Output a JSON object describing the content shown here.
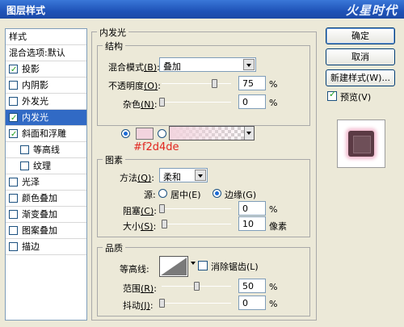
{
  "window": {
    "title": "图层样式",
    "watermark": "火星时代"
  },
  "style_list": {
    "header": "样式",
    "items": [
      {
        "label": "混合选项:默认",
        "checkbox": false
      },
      {
        "label": "投影",
        "checkbox": true,
        "checked": true
      },
      {
        "label": "内阴影",
        "checkbox": true,
        "checked": false
      },
      {
        "label": "外发光",
        "checkbox": true,
        "checked": false
      },
      {
        "label": "内发光",
        "checkbox": true,
        "checked": true,
        "selected": true
      },
      {
        "label": "斜面和浮雕",
        "checkbox": true,
        "checked": true
      },
      {
        "label": "等高线",
        "checkbox": true,
        "checked": false,
        "indent": true
      },
      {
        "label": "纹理",
        "checkbox": true,
        "checked": false,
        "indent": true
      },
      {
        "label": "光泽",
        "checkbox": true,
        "checked": false
      },
      {
        "label": "颜色叠加",
        "checkbox": true,
        "checked": false
      },
      {
        "label": "渐变叠加",
        "checkbox": true,
        "checked": false
      },
      {
        "label": "图案叠加",
        "checkbox": true,
        "checked": false
      },
      {
        "label": "描边",
        "checkbox": true,
        "checked": false
      }
    ]
  },
  "panel": {
    "title": "内发光",
    "structure": {
      "label": "结构",
      "blend_mode": {
        "label": "混合模式",
        "hotkey": "(B)",
        "value": "叠加"
      },
      "opacity": {
        "label": "不透明度",
        "hotkey": "(O)",
        "value": "75",
        "unit": "%",
        "fraction": 0.75
      },
      "noise": {
        "label": "杂色",
        "hotkey": "(N)",
        "value": "0",
        "unit": "%",
        "fraction": 0
      },
      "color_hex": "#f2d4de",
      "color_label": "#f2d4de"
    },
    "elements": {
      "label": "图素",
      "method": {
        "label": "方法",
        "hotkey": "(Q)",
        "value": "柔和"
      },
      "source": {
        "label": "源:",
        "center": "居中(E)",
        "edge": "边缘(G)",
        "selected": "edge"
      },
      "choke": {
        "label": "阻塞",
        "hotkey": "(C)",
        "value": "0",
        "unit": "%",
        "fraction": 0
      },
      "size": {
        "label": "大小",
        "hotkey": "(S)",
        "value": "10",
        "unit": "像素",
        "fraction": 0.04
      }
    },
    "quality": {
      "label": "品质",
      "contour": {
        "label": "等高线:"
      },
      "anti_alias": {
        "label": "消除锯齿(L)",
        "checked": false
      },
      "range": {
        "label": "范围",
        "hotkey": "(R)",
        "value": "50",
        "unit": "%",
        "fraction": 0.5
      },
      "jitter": {
        "label": "抖动",
        "hotkey": "(J)",
        "value": "0",
        "unit": "%",
        "fraction": 0
      }
    }
  },
  "buttons": {
    "ok": "确定",
    "cancel": "取消",
    "new_style": "新建样式(W)..."
  },
  "preview": {
    "label": "预览(V)",
    "checked": true
  }
}
